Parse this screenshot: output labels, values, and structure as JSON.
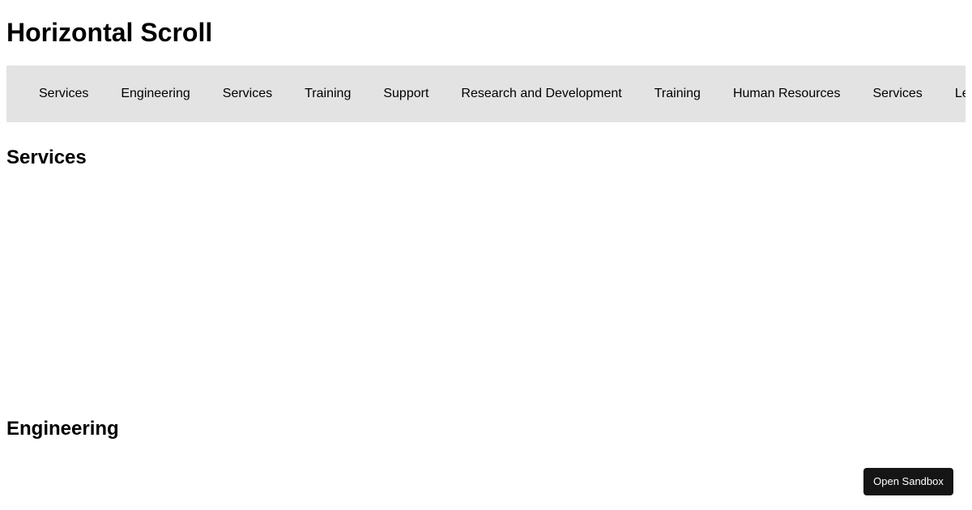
{
  "page": {
    "title": "Horizontal Scroll"
  },
  "nav": {
    "items": [
      {
        "label": "Services"
      },
      {
        "label": "Engineering"
      },
      {
        "label": "Services"
      },
      {
        "label": "Training"
      },
      {
        "label": "Support"
      },
      {
        "label": "Research and Development"
      },
      {
        "label": "Training"
      },
      {
        "label": "Human Resources"
      },
      {
        "label": "Services"
      },
      {
        "label": "Legal"
      }
    ]
  },
  "sections": [
    {
      "heading": "Services"
    },
    {
      "heading": "Engineering"
    }
  ],
  "sandbox": {
    "label": "Open Sandbox"
  },
  "colors": {
    "nav_background": "#e3e3e3",
    "button_background": "#151515",
    "button_text": "#ffffff"
  }
}
